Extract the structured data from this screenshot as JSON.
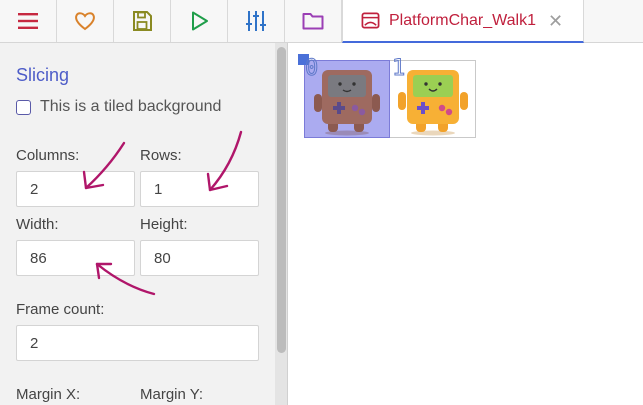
{
  "toolbar": {
    "buttons": [
      {
        "name": "menu",
        "icon": "hamburger-menu-icon",
        "color": "#c62840"
      },
      {
        "name": "favorite",
        "icon": "heart-icon",
        "color": "#d9822b"
      },
      {
        "name": "save",
        "icon": "save-icon",
        "color": "#8a8a22"
      },
      {
        "name": "play",
        "icon": "play-icon",
        "color": "#1f9e4a"
      },
      {
        "name": "adjust",
        "icon": "sliders-icon",
        "color": "#2f73c8"
      },
      {
        "name": "folder",
        "icon": "folder-icon",
        "color": "#9b3fb5"
      }
    ]
  },
  "tab": {
    "icon": "texture-icon",
    "label": "PlatformChar_Walk1",
    "close": "✕"
  },
  "panel": {
    "section_title": "Slicing",
    "tiled_checkbox": {
      "label": "This is a tiled background",
      "checked": false
    },
    "columns": {
      "label": "Columns:",
      "value": "2"
    },
    "rows": {
      "label": "Rows:",
      "value": "1"
    },
    "width": {
      "label": "Width:",
      "value": "86"
    },
    "height": {
      "label": "Height:",
      "value": "80"
    },
    "frame_count": {
      "label": "Frame count:",
      "value": "2"
    },
    "margin_x": {
      "label": "Margin X:"
    },
    "margin_y": {
      "label": "Margin Y:"
    }
  },
  "canvas": {
    "frames": [
      {
        "index": "0",
        "selected": true
      },
      {
        "index": "1",
        "selected": false
      }
    ]
  },
  "colors": {
    "accent": "#446adb",
    "annotation": "#b0166a"
  }
}
